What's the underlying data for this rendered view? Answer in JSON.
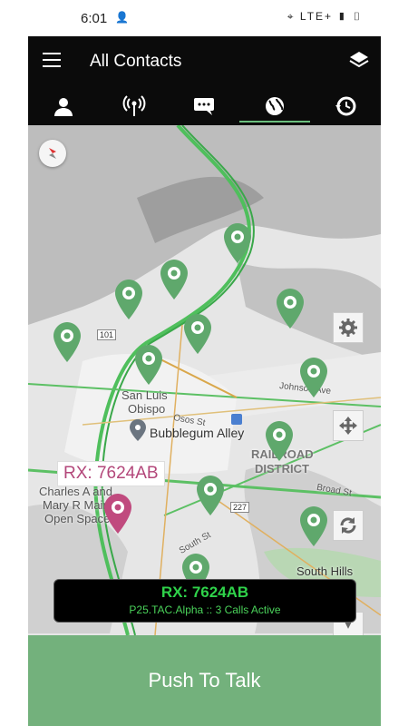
{
  "status_bar": {
    "time": "6:01",
    "network": "LTE+"
  },
  "app_bar": {
    "title": "All Contacts",
    "menu_icon": "menu-icon",
    "layers_icon": "layers-icon"
  },
  "tabs": [
    {
      "name": "contacts",
      "icon": "person-icon"
    },
    {
      "name": "radio",
      "icon": "antenna-icon"
    },
    {
      "name": "messages",
      "icon": "chat-icon"
    },
    {
      "name": "map",
      "icon": "globe-icon",
      "active": true
    },
    {
      "name": "history",
      "icon": "history-icon"
    }
  ],
  "map": {
    "labels": {
      "san_luis": "San Luis",
      "obispo": "Obispo",
      "bubblegum": "Bubblegum Alley",
      "railroad": "RAILROAD",
      "district": "DISTRICT",
      "charles1": "Charles A and",
      "charles2": "Mary R Main",
      "charles3": "Open Space",
      "south_hills": "South Hills",
      "johnson": "Johnson Ave",
      "osos": "Osos St",
      "broad": "Broad St",
      "south_st": "South St",
      "route_101": "101",
      "route_227": "227"
    },
    "selected_label": "RX: 7624AB"
  },
  "rx_box": {
    "rx": "RX: 7624AB",
    "sub": "P25.TAC.Alpha :: 3 Calls Active"
  },
  "ptt": {
    "label": "Push To Talk"
  },
  "colors": {
    "accent": "#73b17c",
    "pin": "#5fa86c",
    "selected_pin": "#c04a7e",
    "bar": "#0b0b0b"
  }
}
